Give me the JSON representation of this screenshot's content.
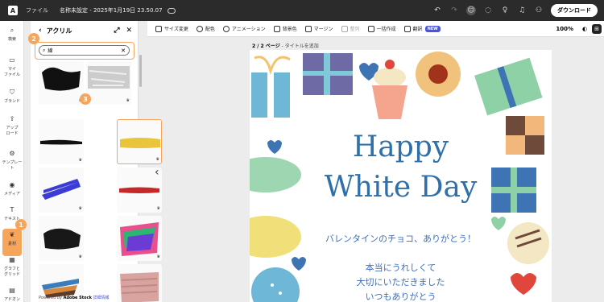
{
  "topbar": {
    "file_menu": "ファイル",
    "doc_title": "名称未設定 - 2025年1月19日 23.50.07",
    "download": "ダウンロード"
  },
  "rail": {
    "items": [
      {
        "label": "検索",
        "icon": "search-icon"
      },
      {
        "label": "マイ\nファイル",
        "icon": "folder-icon"
      },
      {
        "label": "ブランド",
        "icon": "brand-icon"
      },
      {
        "label": "アップ\nロード",
        "icon": "upload-icon"
      },
      {
        "label": "テンプレー\nト",
        "icon": "template-icon"
      },
      {
        "label": "メディア",
        "icon": "media-icon"
      },
      {
        "label": "テキスト",
        "icon": "text-icon"
      },
      {
        "label": "素材",
        "icon": "elements-icon"
      },
      {
        "label": "グラフと\nグリッド",
        "icon": "grid-icon"
      },
      {
        "label": "アドオン",
        "icon": "addon-icon"
      }
    ]
  },
  "panel": {
    "title": "アクリル",
    "search_value": "線",
    "powered_prefix": "Powered by",
    "powered_brand": "Adobe Stock",
    "powered_link": "詳細情報",
    "premium_label": "♛"
  },
  "badges": {
    "one": "1",
    "two": "2",
    "three": "3"
  },
  "toolbar": {
    "resize": "サイズ変更",
    "color": "配色",
    "animation": "アニメーション",
    "background": "背景色",
    "margin": "マージン",
    "arrange": "整列",
    "bulk_create": "一括作成",
    "translate": "翻訳",
    "new_badge": "NEW",
    "zoom": "100%"
  },
  "canvas": {
    "page_num": "2 / 2 ページ",
    "page_title": "- タイトルを追加",
    "greeting_line1": "Happy",
    "greeting_line2": "White Day",
    "message_line1": "バレンタインのチョコ、ありがとう！",
    "message_line2": "本当にうれしくて",
    "message_line3": "大切にいただきました",
    "message_line4": "いつもありがとう"
  },
  "colors": {
    "accent": "#f6a55b",
    "title_blue": "#2f6faa",
    "new_badge": "#4b55d8"
  }
}
